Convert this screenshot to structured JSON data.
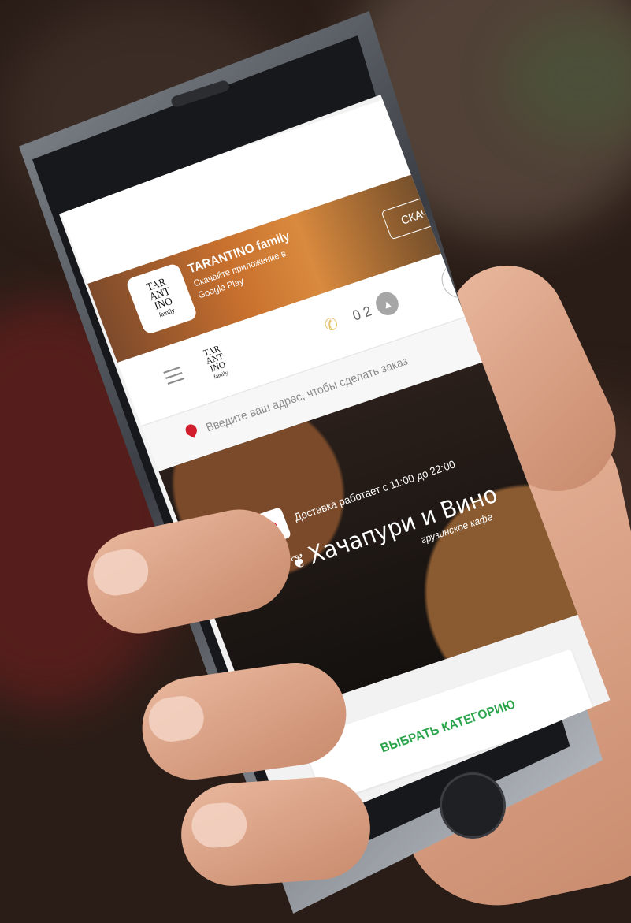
{
  "banner": {
    "app_name": "TARANTINO family",
    "subtitle": "Скачайте приложение в Google Play",
    "download_label": "СКАЧАТЬ",
    "logo_text": [
      "TAR",
      "ANT",
      "INO",
      "family"
    ]
  },
  "header": {
    "logo_text": [
      "TAR",
      "ANT",
      "INO",
      "family"
    ],
    "cart_count": "0 2",
    "icons": {
      "menu": "menu-icon",
      "phone": "phone-icon",
      "cart": "cart-icon",
      "login": "login-icon"
    }
  },
  "address": {
    "placeholder": "Введите ваш адрес, чтобы сделать заказ"
  },
  "hero": {
    "delivery_hours": "Доставка работает с 11:00 до 22:00",
    "brand_name": "Хачапури и Вино",
    "brand_sub": "грузинское кафе"
  },
  "category": {
    "button_label": "ВЫБРАТЬ КАТЕГОРИЮ"
  },
  "colors": {
    "accent_green": "#2aa44a",
    "pin_red": "#d21d2c"
  }
}
